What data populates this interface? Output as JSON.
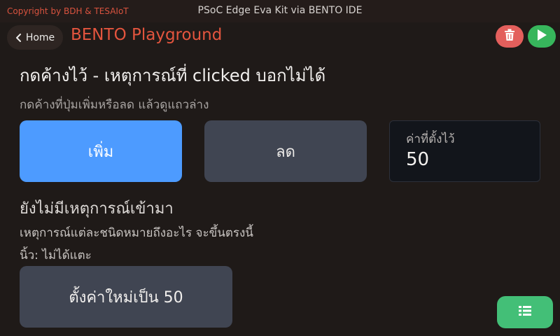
{
  "header": {
    "copyright": "Copyright by BDH & TESAIoT",
    "window_title": "PSoC Edge Eva Kit via BENTO IDE"
  },
  "nav": {
    "home_label": "Home",
    "app_title": "BENTO Playground",
    "delete_icon": "trash-icon",
    "run_icon": "play-icon"
  },
  "main": {
    "heading": "กดค้างไว้ - เหตุการณ์ที่ clicked บอกไม่ได้",
    "instruction": "กดค้างที่ปุ่มเพิ่มหรือลด แล้วดูแถวล่าง",
    "increase_label": "เพิ่ม",
    "decrease_label": "ลด",
    "value_label": "ค่าที่ตั้งไว้",
    "value": "50",
    "status_title": "ยังไม่มีเหตุการณ์เข้ามา",
    "status_description": "เหตุการณ์แต่ละชนิดหมายถึงอะไร จะขึ้นตรงนี้",
    "status_now": "นิ้ว: ไม่ได้แตะ",
    "reset_label": "ตั้งค่าใหม่เป็น 50",
    "list_icon": "list-icon"
  },
  "colors": {
    "accent_red": "#e4553e",
    "primary_blue": "#4d9bff",
    "play_green": "#37b65c",
    "list_green": "#43bf77",
    "delete_red": "#e35f5c"
  }
}
